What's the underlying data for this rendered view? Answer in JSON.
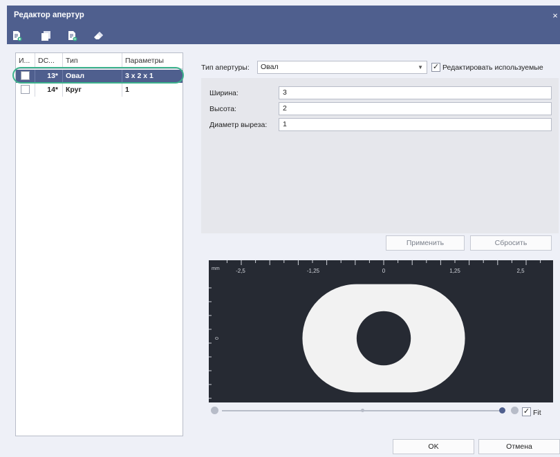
{
  "window": {
    "title": "Редактор апертур",
    "close": "×"
  },
  "toolbar": {
    "icons": [
      "add-document-icon",
      "copy-icon",
      "remove-document-icon",
      "eraser-icon"
    ]
  },
  "grid": {
    "columns": [
      "И...",
      "DC...",
      "Тип",
      "Параметры"
    ],
    "rows": [
      {
        "dcode": "13*",
        "type": "Овал",
        "params": "3 x 2 x 1",
        "selected": true
      },
      {
        "dcode": "14*",
        "type": "Круг",
        "params": "1",
        "selected": false
      }
    ]
  },
  "editor": {
    "type_label": "Тип апертуры:",
    "type_value": "Овал",
    "edit_used_label": "Редактировать используемые",
    "edit_used_checked": true,
    "fields": [
      {
        "label": "Ширина:",
        "value": "3"
      },
      {
        "label": "Высота:",
        "value": "2"
      },
      {
        "label": "Диаметр выреза:",
        "value": "1"
      }
    ],
    "apply": "Применить",
    "reset": "Сбросить"
  },
  "preview": {
    "unit": "mm",
    "ticks": [
      "-2,5",
      "-1,25",
      "0",
      "1,25",
      "2,5"
    ],
    "y_tick": "0",
    "zoom_level": 1.0,
    "fit_label": "Fit",
    "fit_checked": true
  },
  "footer": {
    "ok": "OK",
    "cancel": "Отмена"
  },
  "colors": {
    "titlebar": "#4f5f8e",
    "selection": "#4f5f8e",
    "highlight": "#3cb28c",
    "preview_bg": "#262a33",
    "shape": "#f2f2f2"
  }
}
